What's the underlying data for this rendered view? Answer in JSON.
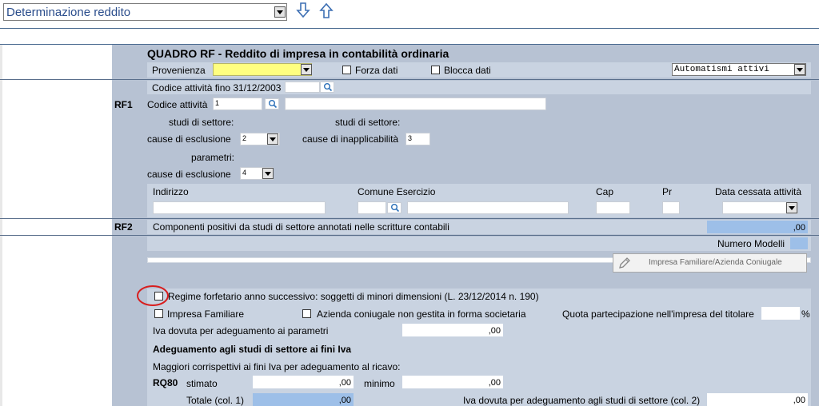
{
  "toolbar": {
    "section_select": "Determinazione reddito"
  },
  "form": {
    "title": "QUADRO RF - Reddito di impresa in contabilità ordinaria",
    "provenienza_label": "Provenienza",
    "forza_dati": "Forza dati",
    "blocca_dati": "Blocca dati",
    "automatismi": "Automatismi attivi",
    "codice_fino_label": "Codice attività fino 31/12/2003",
    "rf1": "RF1",
    "codice_attivita_label": "Codice attività",
    "codice_attivita_value": "1",
    "studi1": "studi di settore:",
    "studi2": "studi di settore:",
    "cause_esclusione": "cause di esclusione",
    "cause_esclusione_value": "2",
    "cause_inapplicabilita": "cause di inapplicabilità",
    "cause_inapplicabilita_value": "3",
    "parametri": "parametri:",
    "cause_esclusione2": "cause di esclusione",
    "cause_esclusione2_value": "4",
    "indirizzo": "Indirizzo",
    "comune": "Comune Esercizio",
    "cap": "Cap",
    "pr": "Pr",
    "data_cessata": "Data cessata attività",
    "rf2": "RF2",
    "componenti": "Componenti positivi da studi di settore annotati nelle scritture contabili",
    "componenti_value": ",00",
    "numero_modelli": "Numero Modelli",
    "impresa_button": "Impresa Familiare/Azienda Coniugale",
    "regime": "Regime forfetario anno successivo: soggetti di minori dimensioni (L. 23/12/2014 n. 190)",
    "impresa_familiare": "Impresa Familiare",
    "azienda_coniugale": "Azienda coniugale non gestita in forma societaria",
    "quota": "Quota partecipazione nell'impresa del titolare",
    "percent": "%",
    "iva_parametri": "Iva dovuta per adeguamento ai parametri",
    "iva_parametri_value": ",00",
    "adeguamento_title": "Adeguamento agli studi di settore ai fini Iva",
    "maggiori": "Maggiori corrispettivi ai fini Iva per adeguamento al ricavo:",
    "rq80": "RQ80",
    "stimato": "stimato",
    "stimato_value": ",00",
    "minimo": "minimo",
    "minimo_value": ",00",
    "totale": "Totale (col. 1)",
    "totale_value": ",00",
    "iva_studi": "Iva dovuta per adeguamento agli studi di settore (col. 2)",
    "iva_studi_value": ",00"
  },
  "colors": {
    "panel": "#b7c2d3",
    "highlight_yellow": "#ffff80",
    "computed_blue": "#9dbfe8",
    "row_line": "#5a6f8c",
    "annotation_red": "#d81e1e"
  }
}
